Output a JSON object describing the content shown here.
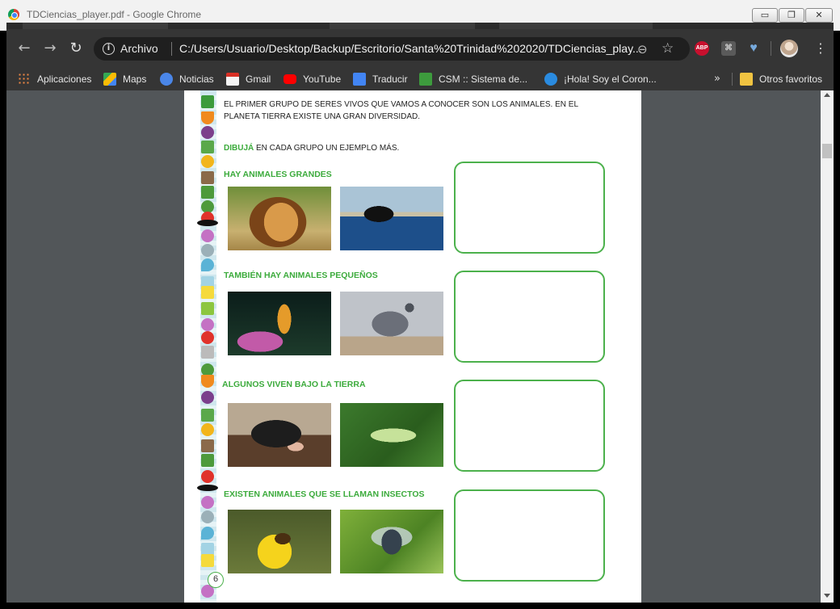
{
  "window": {
    "title": "TDCiencias_player.pdf - Google Chrome",
    "minimize": "▭",
    "maximize": "❐",
    "close": "✕"
  },
  "toolbar": {
    "back_icon": "←",
    "forward_icon": "→",
    "reload_icon": "↻",
    "info_icon": "i",
    "scheme_label": "Archivo",
    "url": "C:/Users/Usuario/Desktop/Backup/Escritorio/Santa%20Trinidad%202020/TDCiencias_play...",
    "zoom_icon": "⊖",
    "star_icon": "☆",
    "abp_label": "ABP",
    "pdf_icon": "⌘",
    "heart_icon": "♥",
    "menu_icon": "⋮"
  },
  "bookmarks": {
    "items": [
      {
        "label": "Aplicaciones",
        "icon": "apps-grid-icon"
      },
      {
        "label": "Maps",
        "icon": "maps-icon"
      },
      {
        "label": "Noticias",
        "icon": "news-icon"
      },
      {
        "label": "Gmail",
        "icon": "gmail-icon"
      },
      {
        "label": "YouTube",
        "icon": "youtube-icon"
      },
      {
        "label": "Traducir",
        "icon": "translate-icon"
      },
      {
        "label": "CSM :: Sistema de...",
        "icon": "csm-icon"
      },
      {
        "label": "¡Hola! Soy el Coron...",
        "icon": "chat-icon"
      }
    ],
    "more": "»",
    "other": "Otros favoritos"
  },
  "document": {
    "intro": "El primer grupo de seres vivos que vamos a conocer son los animales. En el planeta Tierra existe una gran diversidad.",
    "instruction_keyword": "DIBUJÁ",
    "instruction_rest": " EN CADA GRUPO UN EJEMPLO MÁS.",
    "sections": [
      {
        "title": "Hay animales grandes"
      },
      {
        "title": "También hay animales pequeños"
      },
      {
        "title": "Algunos viven bajo la tierra"
      },
      {
        "title": "Existen animales que se llaman insectos"
      }
    ],
    "page_number": "6"
  },
  "colors": {
    "accent_green": "#3cab3c",
    "viewer_bg": "#525659",
    "toolbar_bg": "#353535"
  }
}
